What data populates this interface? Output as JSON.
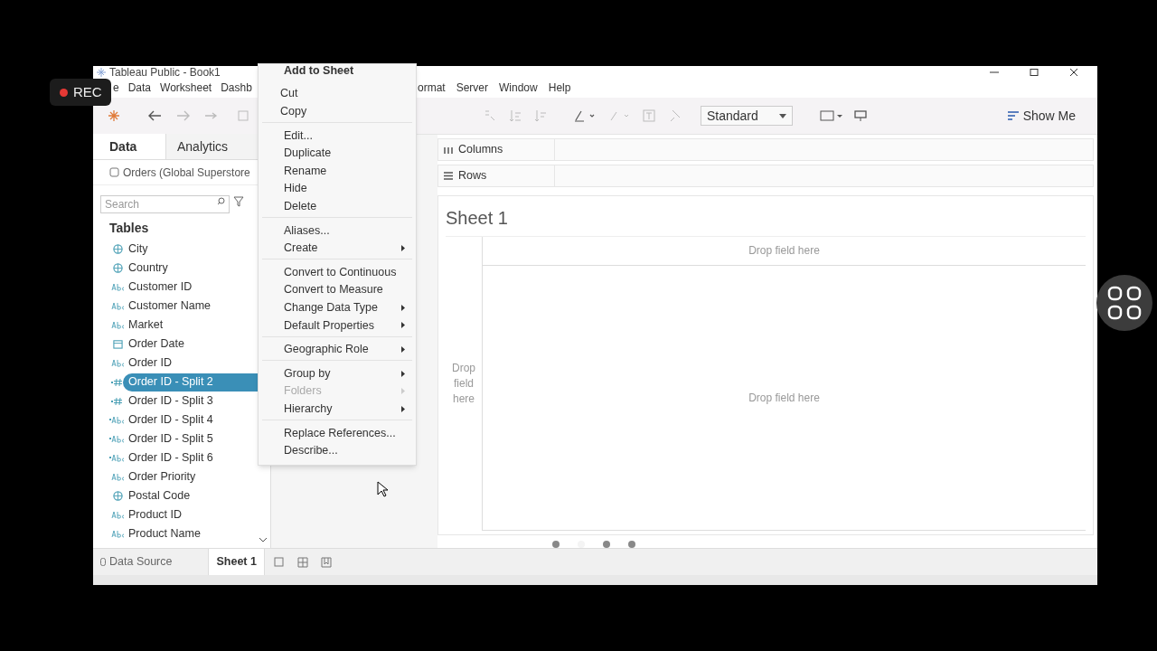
{
  "window": {
    "title": "Tableau Public - Book1"
  },
  "rec_badge": {
    "label": "REC"
  },
  "menu_bar": {
    "left": [
      "e",
      "Data",
      "Worksheet",
      "Dashb"
    ],
    "right": [
      "ormat",
      "Server",
      "Window",
      "Help"
    ]
  },
  "toolbar": {
    "fit_select": "Standard",
    "show_me": "Show Me"
  },
  "side_tabs": [
    {
      "label": "Data",
      "selected": true
    },
    {
      "label": "Analytics",
      "selected": false
    }
  ],
  "data_source": "Orders (Global Superstore",
  "search": {
    "placeholder": "Search"
  },
  "tables_heading": "Tables",
  "fields": [
    {
      "kind": "geo",
      "name": "City",
      "selected": false
    },
    {
      "kind": "geo",
      "name": "Country",
      "selected": false
    },
    {
      "kind": "abc",
      "name": "Customer ID",
      "selected": false
    },
    {
      "kind": "abc",
      "name": "Customer Name",
      "selected": false
    },
    {
      "kind": "abc",
      "name": "Market",
      "selected": false
    },
    {
      "kind": "date",
      "name": "Order Date",
      "selected": false
    },
    {
      "kind": "abc",
      "name": "Order ID",
      "selected": false
    },
    {
      "kind": "num-split",
      "name": "Order ID - Split 2",
      "selected": true
    },
    {
      "kind": "num-split",
      "name": "Order ID - Split 3",
      "selected": false
    },
    {
      "kind": "abc-split",
      "name": "Order ID - Split 4",
      "selected": false
    },
    {
      "kind": "abc-split",
      "name": "Order ID - Split 5",
      "selected": false
    },
    {
      "kind": "abc-split",
      "name": "Order ID - Split 6",
      "selected": false
    },
    {
      "kind": "abc",
      "name": "Order Priority",
      "selected": false
    },
    {
      "kind": "geo",
      "name": "Postal Code",
      "selected": false
    },
    {
      "kind": "abc",
      "name": "Product ID",
      "selected": false
    },
    {
      "kind": "abc",
      "name": "Product Name",
      "selected": false
    }
  ],
  "shelves": [
    {
      "kind": "columns",
      "label": "Columns"
    },
    {
      "kind": "rows",
      "label": "Rows"
    }
  ],
  "sheet": {
    "title": "Sheet 1",
    "drop_top": "Drop field here",
    "drop_left": "Drop field here",
    "drop_center": "Drop field here"
  },
  "sheet_tabs": [
    {
      "label": "Data Source",
      "selected": false
    },
    {
      "label": "Sheet 1",
      "selected": true
    }
  ],
  "page_dots": [
    {
      "selected": false
    },
    {
      "selected": true
    },
    {
      "selected": false
    },
    {
      "selected": false
    }
  ],
  "context_menu": {
    "title": "Add to Sheet",
    "groups": [
      [
        {
          "label": "Cut",
          "submenu": false,
          "disabled": false
        },
        {
          "label": "Copy",
          "submenu": false,
          "disabled": false
        }
      ],
      [
        {
          "label": "Edit...",
          "submenu": false,
          "disabled": false
        },
        {
          "label": "Duplicate",
          "submenu": false,
          "disabled": false
        },
        {
          "label": "Rename",
          "submenu": false,
          "disabled": false
        },
        {
          "label": "Hide",
          "submenu": false,
          "disabled": false
        },
        {
          "label": "Delete",
          "submenu": false,
          "disabled": false
        }
      ],
      [
        {
          "label": "Aliases...",
          "submenu": false,
          "disabled": false
        },
        {
          "label": "Create",
          "submenu": true,
          "disabled": false
        }
      ],
      [
        {
          "label": "Convert to Continuous",
          "submenu": false,
          "disabled": false
        },
        {
          "label": "Convert to Measure",
          "submenu": false,
          "disabled": false
        },
        {
          "label": "Change Data Type",
          "submenu": true,
          "disabled": false
        },
        {
          "label": "Default Properties",
          "submenu": true,
          "disabled": false
        }
      ],
      [
        {
          "label": "Geographic Role",
          "submenu": true,
          "disabled": false
        }
      ],
      [
        {
          "label": "Group by",
          "submenu": true,
          "disabled": false
        },
        {
          "label": "Folders",
          "submenu": true,
          "disabled": true
        },
        {
          "label": "Hierarchy",
          "submenu": true,
          "disabled": false
        }
      ],
      [
        {
          "label": "Replace References...",
          "submenu": false,
          "disabled": false
        },
        {
          "label": "Describe...",
          "submenu": false,
          "disabled": false
        }
      ]
    ]
  }
}
